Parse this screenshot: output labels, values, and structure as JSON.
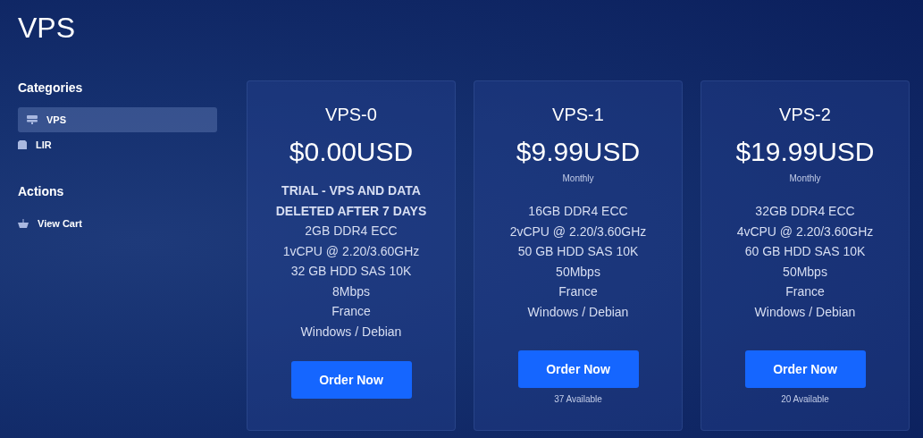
{
  "page_title": "VPS",
  "sidebar": {
    "sections": [
      {
        "heading": "Categories",
        "items": [
          {
            "label": "VPS",
            "kind": "server",
            "selected": true
          },
          {
            "label": "LIR",
            "kind": "box",
            "selected": false
          }
        ]
      },
      {
        "heading": "Actions",
        "items": [
          {
            "label": "View Cart",
            "kind": "basket",
            "selected": false
          }
        ]
      }
    ]
  },
  "products": [
    {
      "name": "VPS-0",
      "price": "$0.00USD",
      "features": [
        {
          "kind": "note",
          "text": "TRIAL - VPS AND DATA DELETED AFTER 7 DAYS"
        },
        {
          "kind": "spec",
          "text": "2GB DDR4 ECC"
        },
        {
          "kind": "spec",
          "text": "1vCPU @ 2.20/3.60GHz"
        },
        {
          "kind": "spec",
          "text": "32 GB HDD SAS 10K"
        },
        {
          "kind": "spec",
          "text": "8Mbps"
        },
        {
          "kind": "spec",
          "text": "France"
        },
        {
          "kind": "spec",
          "text": "Windows / Debian"
        }
      ],
      "button": "Order Now"
    },
    {
      "name": "VPS-1",
      "price": "$9.99USD",
      "cycle": "Monthly",
      "features": [
        {
          "kind": "spec",
          "text": "16GB DDR4 ECC"
        },
        {
          "kind": "spec",
          "text": "2vCPU @ 2.20/3.60GHz"
        },
        {
          "kind": "spec",
          "text": "50 GB HDD SAS 10K"
        },
        {
          "kind": "spec",
          "text": "50Mbps"
        },
        {
          "kind": "spec",
          "text": "France"
        },
        {
          "kind": "spec",
          "text": "Windows / Debian"
        }
      ],
      "button": "Order Now",
      "availability": "37 Available"
    },
    {
      "name": "VPS-2",
      "price": "$19.99USD",
      "cycle": "Monthly",
      "features": [
        {
          "kind": "spec",
          "text": "32GB DDR4 ECC"
        },
        {
          "kind": "spec",
          "text": "4vCPU @ 2.20/3.60GHz"
        },
        {
          "kind": "spec",
          "text": "60 GB HDD SAS 10K"
        },
        {
          "kind": "spec",
          "text": "50Mbps"
        },
        {
          "kind": "spec",
          "text": "France"
        },
        {
          "kind": "spec",
          "text": "Windows / Debian"
        }
      ],
      "button": "Order Now",
      "availability": "20 Available"
    }
  ]
}
